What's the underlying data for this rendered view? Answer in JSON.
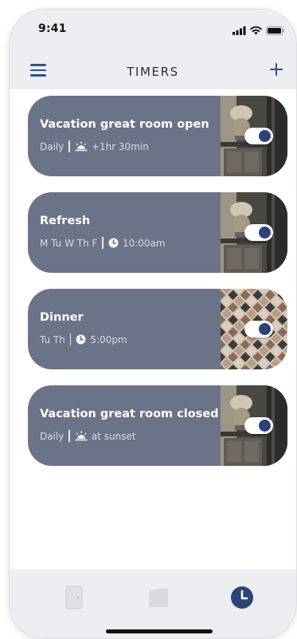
{
  "status_bar": {
    "time": "9:41",
    "icons": [
      "signal-icon",
      "wifi-icon",
      "battery-icon"
    ]
  },
  "header": {
    "title": "TIMERS",
    "menu_icon": "hamburger-menu-icon",
    "add_icon": "plus-icon"
  },
  "colors": {
    "card_bg": "#6b7388",
    "accent": "#2d4377",
    "header_bg": "#eceef2"
  },
  "timers": [
    {
      "title": "Vacation great room open",
      "days": "Daily",
      "schedule_icon": "sunrise-icon",
      "time": "+1hr 30min",
      "enabled": true,
      "photo": "room-photo"
    },
    {
      "title": "Refresh",
      "days": "M Tu W Th F",
      "schedule_icon": "clock-icon",
      "time": "10:00am",
      "enabled": true,
      "photo": "room-photo"
    },
    {
      "title": "Dinner",
      "days": "Tu Th",
      "schedule_icon": "clock-icon",
      "time": "5:00pm",
      "enabled": true,
      "photo": "tile-floor-photo"
    },
    {
      "title": "Vacation great room closed",
      "days": "Daily",
      "schedule_icon": "sunset-icon",
      "time": "at sunset",
      "enabled": true,
      "photo": "room-photo"
    }
  ],
  "tab_bar": {
    "tabs": [
      {
        "icon": "door-icon",
        "active": false
      },
      {
        "icon": "shade-icon",
        "active": false
      },
      {
        "icon": "clock-icon",
        "active": true
      }
    ]
  }
}
